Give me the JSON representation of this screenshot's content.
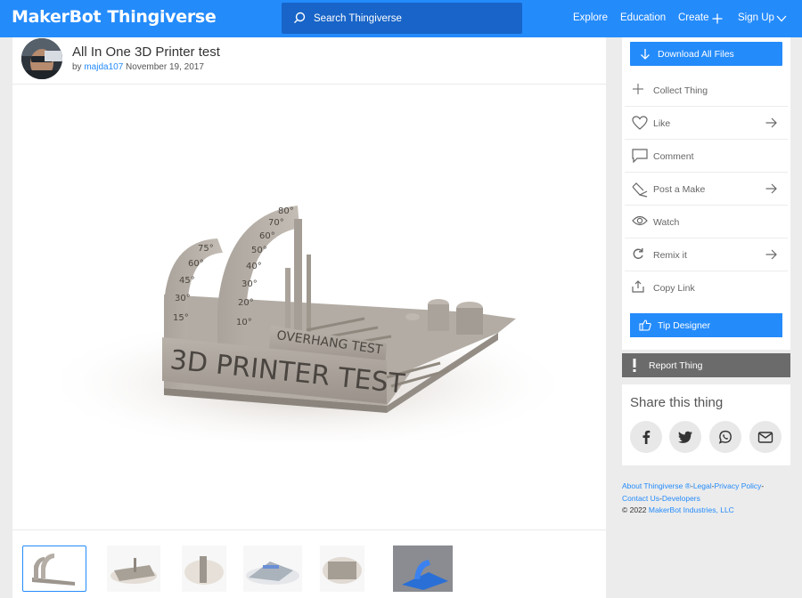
{
  "header": {
    "logo_brand": "MakerBot",
    "logo_product": "Thingiverse",
    "search_placeholder": "Search Thingiverse",
    "nav": {
      "explore": "Explore",
      "education": "Education",
      "create": "Create",
      "signup": "Sign Up"
    }
  },
  "thing": {
    "title": "All In One 3D Printer test",
    "by": "by",
    "author": "majda107",
    "date": "November 19, 2017"
  },
  "hero": {
    "main_text": "3D PRINTER TEST",
    "sub_text": "OVERHANG TEST",
    "arc_left_labels": [
      "75°",
      "60°",
      "45°",
      "30°",
      "15°"
    ],
    "arc_right_labels": [
      "80°",
      "70°",
      "60°",
      "50°",
      "40°",
      "30°",
      "20°",
      "10°"
    ]
  },
  "thumbnails": {
    "count": 6,
    "active_index": 0
  },
  "sidebar": {
    "download": "Download All Files",
    "actions": [
      {
        "label": "Collect Thing",
        "icon": "plus-icon",
        "arrow": false
      },
      {
        "label": "Like",
        "icon": "heart-icon",
        "arrow": true
      },
      {
        "label": "Comment",
        "icon": "comment-icon",
        "arrow": false
      },
      {
        "label": "Post a Make",
        "icon": "post-make-icon",
        "arrow": true
      },
      {
        "label": "Watch",
        "icon": "eye-icon",
        "arrow": false
      },
      {
        "label": "Remix it",
        "icon": "remix-icon",
        "arrow": true
      },
      {
        "label": "Copy Link",
        "icon": "share-icon",
        "arrow": false
      }
    ],
    "tip": "Tip Designer",
    "report": "Report Thing"
  },
  "share": {
    "title": "Share this thing",
    "buttons": [
      "facebook-icon",
      "twitter-icon",
      "whatsapp-icon",
      "email-icon"
    ]
  },
  "footer": {
    "links": [
      "About Thingiverse ®",
      "Legal",
      "Privacy Policy",
      "Contact Us",
      "Developers"
    ],
    "copyright": "© 2022",
    "company": "MakerBot Industries, LLC"
  },
  "colors": {
    "brand_blue": "#248bfb",
    "search_bg": "#1864c8",
    "report_gray": "#6b6b6b"
  }
}
